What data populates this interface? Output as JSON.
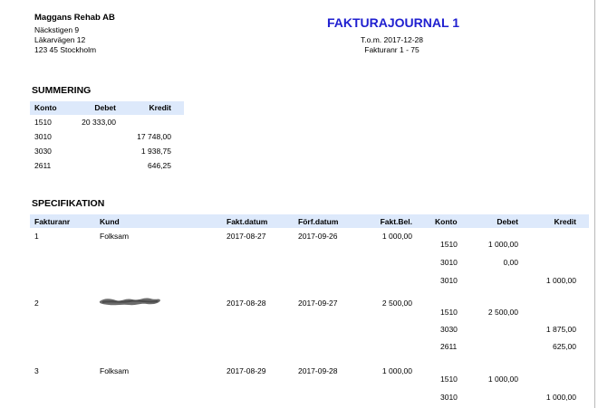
{
  "company": {
    "name": "Maggans Rehab AB",
    "address_lines": [
      "Näckstigen 9",
      "Läkarvägen 12",
      "123 45 Stockholm"
    ]
  },
  "report": {
    "title": "FAKTURAJOURNAL 1",
    "period": "T.o.m. 2017-12-28",
    "range": "Fakturanr 1 - 75"
  },
  "summary": {
    "title": "SUMMERING",
    "columns": [
      "Konto",
      "Debet",
      "Kredit"
    ],
    "rows": [
      {
        "konto": "1510",
        "debet": "20 333,00",
        "kredit": ""
      },
      {
        "konto": "3010",
        "debet": "",
        "kredit": "17 748,00"
      },
      {
        "konto": "3030",
        "debet": "",
        "kredit": "1 938,75"
      },
      {
        "konto": "2611",
        "debet": "",
        "kredit": "646,25"
      }
    ]
  },
  "specification": {
    "title": "SPECIFIKATION",
    "columns": [
      "Fakturanr",
      "Kund",
      "Fakt.datum",
      "Förf.datum",
      "Fakt.Bel.",
      "Konto",
      "Debet",
      "Kredit"
    ],
    "invoices": [
      {
        "fakturanr": "1",
        "kund": "Folksam",
        "fakt_datum": "2017-08-27",
        "forf_datum": "2017-09-26",
        "belopp": "1 000,00",
        "lines": [
          {
            "konto": "1510",
            "debet": "1 000,00",
            "kredit": ""
          },
          {
            "konto": "3010",
            "debet": "0,00",
            "kredit": ""
          },
          {
            "konto": "3010",
            "debet": "",
            "kredit": "1 000,00"
          }
        ]
      },
      {
        "fakturanr": "2",
        "kund": "",
        "kund_redacted": true,
        "fakt_datum": "2017-08-28",
        "forf_datum": "2017-09-27",
        "belopp": "2 500,00",
        "lines": [
          {
            "konto": "1510",
            "debet": "2 500,00",
            "kredit": ""
          },
          {
            "konto": "3030",
            "debet": "",
            "kredit": "1 875,00"
          },
          {
            "konto": "2611",
            "debet": "",
            "kredit": "625,00"
          }
        ]
      },
      {
        "fakturanr": "3",
        "kund": "Folksam",
        "fakt_datum": "2017-08-29",
        "forf_datum": "2017-09-28",
        "belopp": "1 000,00",
        "lines": [
          {
            "konto": "1510",
            "debet": "1 000,00",
            "kredit": ""
          },
          {
            "konto": "3010",
            "debet": "",
            "kredit": "1 000,00"
          }
        ]
      }
    ]
  },
  "colors": {
    "title": "#2020d0",
    "header_band": "#dde9fb"
  }
}
